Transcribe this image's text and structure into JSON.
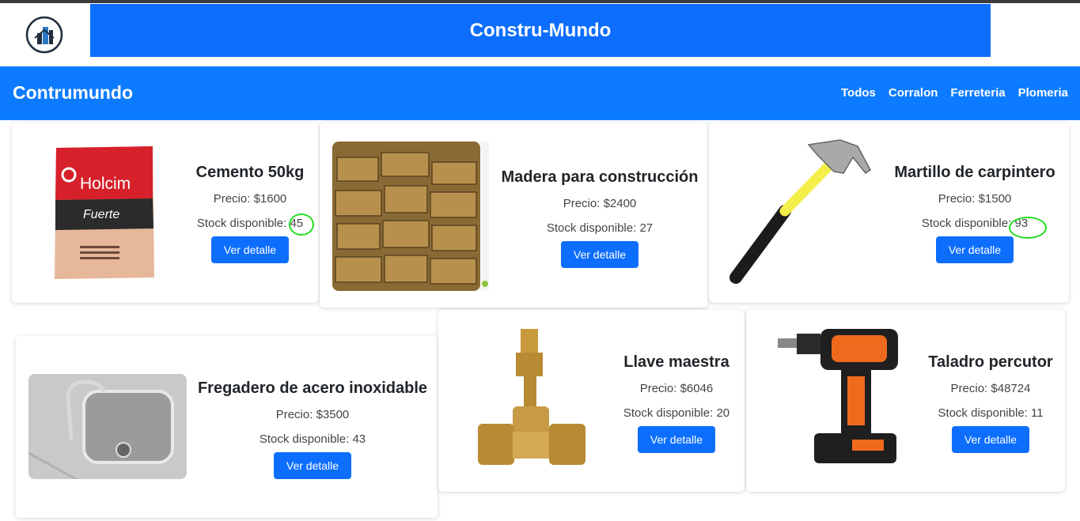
{
  "header": {
    "banner_title": "Constru-Mundo"
  },
  "navbar": {
    "brand": "Contrumundo",
    "links": [
      "Todos",
      "Corralon",
      "Ferreteria",
      "Plomeria"
    ]
  },
  "labels": {
    "price_prefix": "Precio: ",
    "stock_prefix": "Stock disponible: ",
    "detail_button": "Ver detalle"
  },
  "products": [
    {
      "name": "Cemento 50kg",
      "price": "$1600",
      "stock": "45",
      "brand_print": "Holcim",
      "variant_print": "Fuerte"
    },
    {
      "name": "Madera para construcción",
      "price": "$2400",
      "stock": "27"
    },
    {
      "name": "Martillo de carpintero",
      "price": "$1500",
      "stock": "93"
    },
    {
      "name": "Fregadero de acero inoxidable",
      "price": "$3500",
      "stock": "43"
    },
    {
      "name": "Llave maestra",
      "price": "$6046",
      "stock": "20"
    },
    {
      "name": "Taladro percutor",
      "price": "$48724",
      "stock": "11"
    }
  ],
  "colors": {
    "primary": "#0d6efd",
    "navbar": "#0d7bff",
    "highlight": "#22dd22"
  }
}
